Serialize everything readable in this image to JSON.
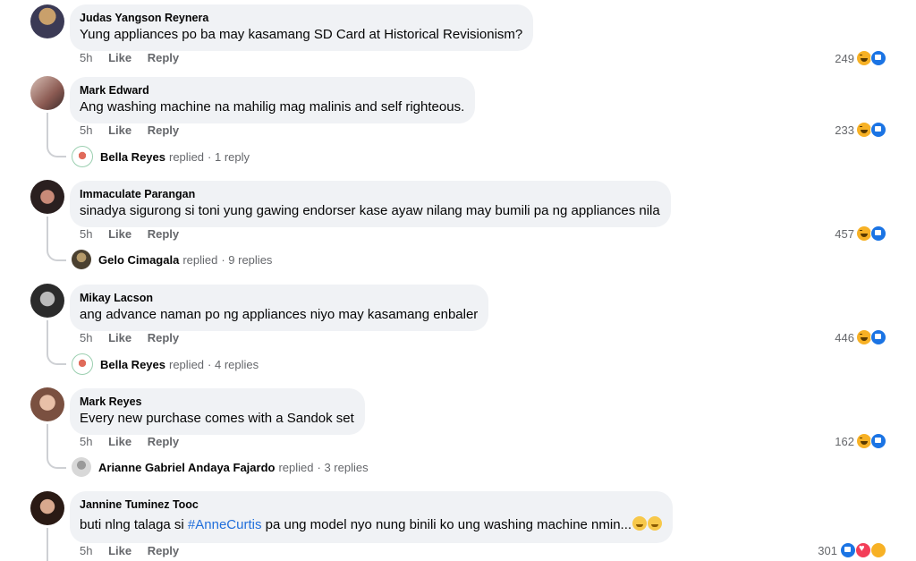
{
  "comments": [
    {
      "author": "Judas Yangson Reynera",
      "text": "Yung appliances po ba may kasamang SD Card at Historical Revisionism?",
      "time": "5h",
      "like": "Like",
      "reply": "Reply",
      "count": "249"
    },
    {
      "author": "Mark Edward",
      "text": "Ang washing machine na mahilig mag malinis and self righteous.",
      "time": "5h",
      "like": "Like",
      "reply": "Reply",
      "count": "233",
      "replier": "Bella Reyes",
      "replied": "replied",
      "replies": "· 1 reply"
    },
    {
      "author": "Immaculate Parangan",
      "text": "sinadya sigurong si toni yung gawing endorser kase ayaw nilang may bumili pa ng appliances nila",
      "time": "5h",
      "like": "Like",
      "reply": "Reply",
      "count": "457",
      "replier": "Gelo Cimagala",
      "replied": "replied",
      "replies": "· 9 replies"
    },
    {
      "author": "Mikay Lacson",
      "text": "ang advance naman po ng appliances niyo may kasamang enbaler",
      "time": "5h",
      "like": "Like",
      "reply": "Reply",
      "count": "446",
      "replier": "Bella Reyes",
      "replied": "replied",
      "replies": "· 4 replies"
    },
    {
      "author": "Mark Reyes",
      "text": "Every new purchase comes with a Sandok set",
      "time": "5h",
      "like": "Like",
      "reply": "Reply",
      "count": "162",
      "replier": "Arianne Gabriel Andaya Fajardo",
      "replied": "replied",
      "replies": "· 3 replies"
    },
    {
      "author": "Jannine Tuminez Tooc",
      "text_before": "buti nlng talaga si ",
      "hashtag": "#AnneCurtis",
      "text_after": " pa ung model nyo nung binili ko ung washing machine nmin...",
      "time": "5h",
      "like": "Like",
      "reply": "Reply",
      "count": "301"
    }
  ],
  "icons": {
    "haha": "haha-reaction-icon",
    "like": "like-reaction-icon",
    "love": "love-reaction-icon",
    "care": "care-reaction-icon"
  },
  "colors": {
    "bubble": "#f0f2f5",
    "meta": "#65676b",
    "hashtag": "#216fdb",
    "like_blue": "#1b74e4",
    "haha_yellow": "#f7b125",
    "love_red": "#f33e58"
  }
}
